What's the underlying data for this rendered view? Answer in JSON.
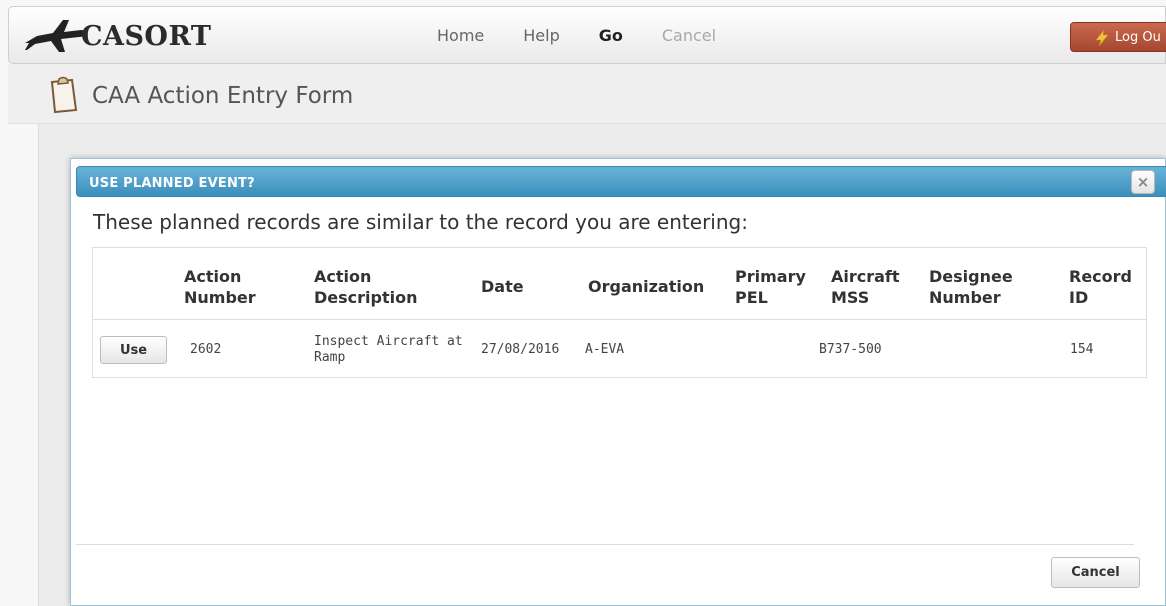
{
  "app": {
    "name": "CASORT",
    "logo_icon": "airplane-icon"
  },
  "nav": {
    "links": [
      "Home",
      "Help",
      "Go",
      "Cancel"
    ],
    "logout_label": "Log Ou",
    "logout_icon": "lightning-icon"
  },
  "page": {
    "title": "CAA Action Entry Form",
    "icon": "clipboard-icon"
  },
  "modal": {
    "title": "USE PLANNED EVENT?",
    "close_icon": "close-icon",
    "message": "These planned records are similar to the record you are entering:",
    "columns": [
      [
        "Action",
        "Number"
      ],
      [
        "Action",
        "Description"
      ],
      [
        "Date"
      ],
      [
        "Organization"
      ],
      [
        "Primary",
        "PEL"
      ],
      [
        "Aircraft",
        "MSS"
      ],
      [
        "Designee",
        "Number"
      ],
      [
        "Record",
        "ID"
      ]
    ],
    "rows": [
      {
        "use_label": "Use",
        "action_number": "2602",
        "action_description": [
          "Inspect Aircraft at",
          "Ramp"
        ],
        "date": "27/08/2016",
        "organization": "A-EVA",
        "primary_pel": "",
        "aircraft_mss": "B737-500",
        "designee_number": "",
        "record_id": "154"
      }
    ],
    "cancel_label": "Cancel"
  },
  "colors": {
    "modal_header": "#4a9ec9",
    "logout_button": "#b5553b"
  }
}
